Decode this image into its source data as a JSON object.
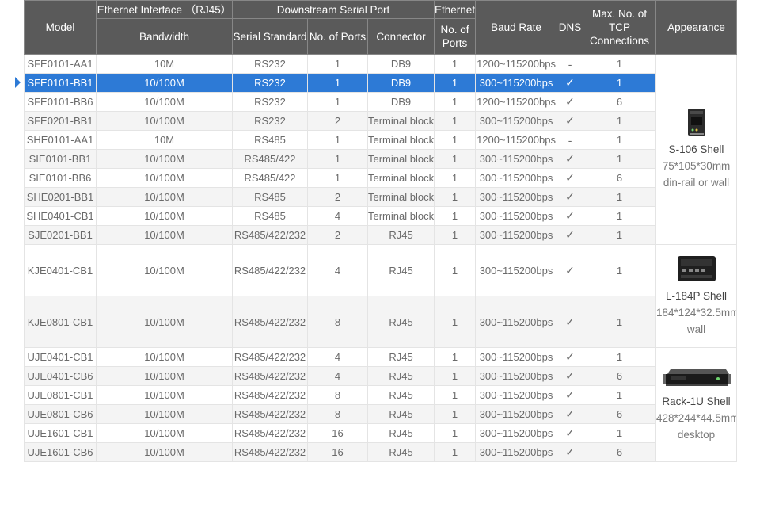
{
  "table": {
    "headers": {
      "model": "Model",
      "ethernet_interface": "Ethernet Interface （RJ45）",
      "bandwidth": "Bandwidth",
      "downstream_serial_port": "Downstream Serial Port",
      "serial_standard": "Serial Standard",
      "no_of_ports": "No. of Ports",
      "connector": "Connector",
      "ethernet": "Ethernet",
      "ethernet_no_of_ports": "No. of Ports",
      "baud_rate": "Baud Rate",
      "dns": "DNS",
      "max_tcp": "Max. No. of TCP Connections",
      "appearance": "Appearance"
    },
    "selected_row_index": 1,
    "rows": [
      {
        "model": "SFE0101-AA1",
        "bandwidth": "10M",
        "serial_standard": "RS232",
        "ports": "1",
        "connector": "DB9",
        "eth_ports": "1",
        "baud": "1200~115200bps",
        "dns": "-",
        "tcp": "1"
      },
      {
        "model": "SFE0101-BB1",
        "bandwidth": "10/100M",
        "serial_standard": "RS232",
        "ports": "1",
        "connector": "DB9",
        "eth_ports": "1",
        "baud": "300~115200bps",
        "dns": "✓",
        "tcp": "1"
      },
      {
        "model": "SFE0101-BB6",
        "bandwidth": "10/100M",
        "serial_standard": "RS232",
        "ports": "1",
        "connector": "DB9",
        "eth_ports": "1",
        "baud": "1200~115200bps",
        "dns": "✓",
        "tcp": "6"
      },
      {
        "model": "SFE0201-BB1",
        "bandwidth": "10/100M",
        "serial_standard": "RS232",
        "ports": "2",
        "connector": "Terminal block",
        "eth_ports": "1",
        "baud": "300~115200bps",
        "dns": "✓",
        "tcp": "1"
      },
      {
        "model": "SHE0101-AA1",
        "bandwidth": "10M",
        "serial_standard": "RS485",
        "ports": "1",
        "connector": "Terminal block",
        "eth_ports": "1",
        "baud": "1200~115200bps",
        "dns": "-",
        "tcp": "1"
      },
      {
        "model": "SIE0101-BB1",
        "bandwidth": "10/100M",
        "serial_standard": "RS485/422",
        "ports": "1",
        "connector": "Terminal block",
        "eth_ports": "1",
        "baud": "300~115200bps",
        "dns": "✓",
        "tcp": "1"
      },
      {
        "model": "SIE0101-BB6",
        "bandwidth": "10/100M",
        "serial_standard": "RS485/422",
        "ports": "1",
        "connector": "Terminal block",
        "eth_ports": "1",
        "baud": "300~115200bps",
        "dns": "✓",
        "tcp": "6"
      },
      {
        "model": "SHE0201-BB1",
        "bandwidth": "10/100M",
        "serial_standard": "RS485",
        "ports": "2",
        "connector": "Terminal block",
        "eth_ports": "1",
        "baud": "300~115200bps",
        "dns": "✓",
        "tcp": "1"
      },
      {
        "model": "SHE0401-CB1",
        "bandwidth": "10/100M",
        "serial_standard": "RS485",
        "ports": "4",
        "connector": "Terminal block",
        "eth_ports": "1",
        "baud": "300~115200bps",
        "dns": "✓",
        "tcp": "1"
      },
      {
        "model": "SJE0201-BB1",
        "bandwidth": "10/100M",
        "serial_standard": "RS485/422/232",
        "ports": "2",
        "connector": "RJ45",
        "eth_ports": "1",
        "baud": "300~115200bps",
        "dns": "✓",
        "tcp": "1"
      },
      {
        "model": "KJE0401-CB1",
        "bandwidth": "10/100M",
        "serial_standard": "RS485/422/232",
        "ports": "4",
        "connector": "RJ45",
        "eth_ports": "1",
        "baud": "300~115200bps",
        "dns": "✓",
        "tcp": "1"
      },
      {
        "model": "KJE0801-CB1",
        "bandwidth": "10/100M",
        "serial_standard": "RS485/422/232",
        "ports": "8",
        "connector": "RJ45",
        "eth_ports": "1",
        "baud": "300~115200bps",
        "dns": "✓",
        "tcp": "1"
      },
      {
        "model": "UJE0401-CB1",
        "bandwidth": "10/100M",
        "serial_standard": "RS485/422/232",
        "ports": "4",
        "connector": "RJ45",
        "eth_ports": "1",
        "baud": "300~115200bps",
        "dns": "✓",
        "tcp": "1"
      },
      {
        "model": "UJE0401-CB6",
        "bandwidth": "10/100M",
        "serial_standard": "RS485/422/232",
        "ports": "4",
        "connector": "RJ45",
        "eth_ports": "1",
        "baud": "300~115200bps",
        "dns": "✓",
        "tcp": "6"
      },
      {
        "model": "UJE0801-CB1",
        "bandwidth": "10/100M",
        "serial_standard": "RS485/422/232",
        "ports": "8",
        "connector": "RJ45",
        "eth_ports": "1",
        "baud": "300~115200bps",
        "dns": "✓",
        "tcp": "1"
      },
      {
        "model": "UJE0801-CB6",
        "bandwidth": "10/100M",
        "serial_standard": "RS485/422/232",
        "ports": "8",
        "connector": "RJ45",
        "eth_ports": "1",
        "baud": "300~115200bps",
        "dns": "✓",
        "tcp": "6"
      },
      {
        "model": "UJE1601-CB1",
        "bandwidth": "10/100M",
        "serial_standard": "RS485/422/232",
        "ports": "16",
        "connector": "RJ45",
        "eth_ports": "1",
        "baud": "300~115200bps",
        "dns": "✓",
        "tcp": "1"
      },
      {
        "model": "UJE1601-CB6",
        "bandwidth": "10/100M",
        "serial_standard": "RS485/422/232",
        "ports": "16",
        "connector": "RJ45",
        "eth_ports": "1",
        "baud": "300~115200bps",
        "dns": "✓",
        "tcp": "6"
      }
    ],
    "appearance_groups": [
      {
        "name": "S-106 Shell",
        "dims": "75*105*30mm",
        "mount": "din-rail or wall",
        "icon": "din-rail-device-icon"
      },
      {
        "name": "L-184P Shell",
        "dims": "184*124*32.5mm",
        "mount": "wall",
        "icon": "wall-mount-device-icon"
      },
      {
        "name": "Rack-1U Shell",
        "dims": "428*244*44.5mm",
        "mount": "desktop",
        "icon": "rack-device-icon"
      }
    ]
  },
  "colors": {
    "header_bg": "#5a5a5a",
    "selected_row": "#2d7ad6",
    "stripe": "#f4f4f4"
  }
}
